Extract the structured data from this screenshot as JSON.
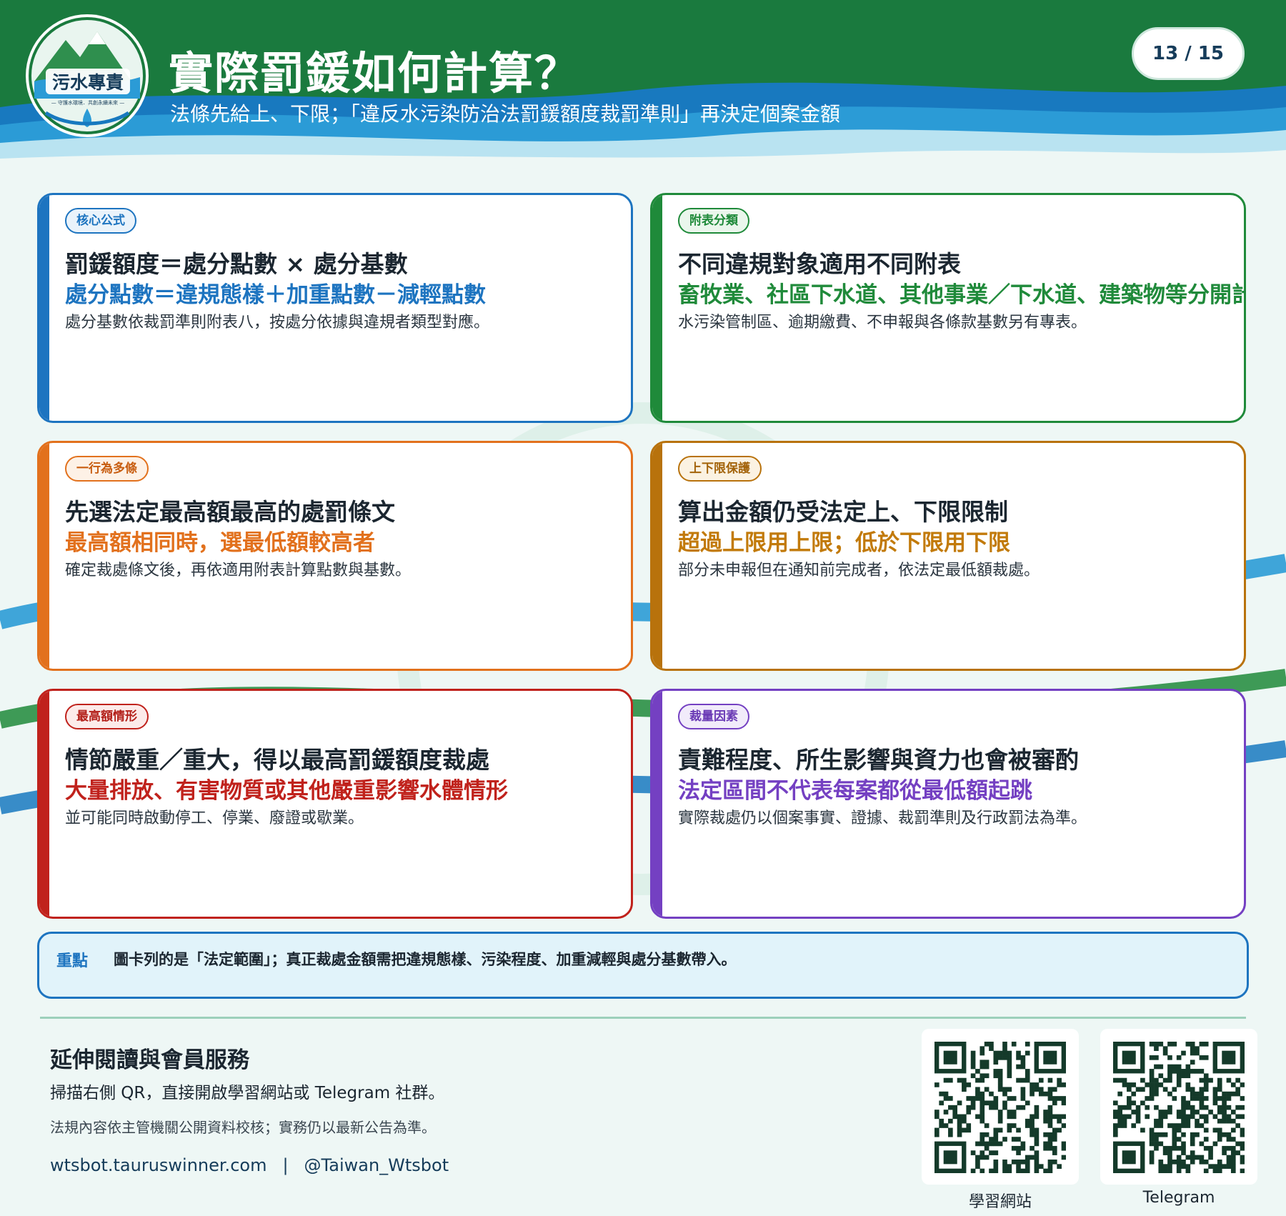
{
  "header": {
    "title": "實際罰鍰如何計算？",
    "subtitle": "法條先給上、下限；「違反水污染防治法罰鍰額度裁罰準則」再決定個案金額",
    "page_indicator": "13 / 15",
    "logo": {
      "icon": "mountain-river-logo",
      "text": "污水專責",
      "tagline": "— 守護水環境．共創永續未來 —"
    }
  },
  "cards": [
    {
      "tag": "核心公式",
      "headline": "罰鍰額度＝處分點數 × 處分基數",
      "accent": "處分點數＝違規態樣＋加重點數－減輕點數",
      "desc": "處分基數依裁罰準則附表八，按處分依據與違規者類型對應。",
      "color": "#1d74c0"
    },
    {
      "tag": "附表分類",
      "headline": "不同違規對象適用不同附表",
      "accent": "畜牧業、社區下水道、其他事業／下水道、建築物等分開計算",
      "desc": "水污染管制區、逾期繳費、不申報與各條款基數另有專表。",
      "color": "#1f8a3a"
    },
    {
      "tag": "一行為多條",
      "headline": "先選法定最高額最高的處罰條文",
      "accent": "最高額相同時，選最低額較高者",
      "desc": "確定裁處條文後，再依適用附表計算點數與基數。",
      "color": "#e2711d"
    },
    {
      "tag": "上下限保護",
      "headline": "算出金額仍受法定上、下限限制",
      "accent": "超過上限用上限；低於下限用下限",
      "desc": "部分未申報但在通知前完成者，依法定最低額裁處。",
      "color": "#b8720c"
    },
    {
      "tag": "最高額情形",
      "headline": "情節嚴重／重大，得以最高罰鍰額度裁處",
      "accent": "大量排放、有害物質或其他嚴重影響水體情形",
      "desc": "並可能同時啟動停工、停業、廢證或歇業。",
      "color": "#c0221c"
    },
    {
      "tag": "裁量因素",
      "headline": "責難程度、所生影響與資力也會被審酌",
      "accent": "法定區間不代表每案都從最低額起跳",
      "desc": "實際裁處仍以個案事實、證據、裁罰準則及行政罰法為準。",
      "color": "#7440c2"
    }
  ],
  "note": {
    "label": "重點",
    "text": "圖卡列的是「法定範圍」；真正裁處金額需把違規態樣、污染程度、加重減輕與處分基數帶入。"
  },
  "footer": {
    "title": "延伸閱讀與會員服務",
    "line1": "掃描右側 QR，直接開啟學習網站或 Telegram 社群。",
    "line2": "法規內容依主管機關公開資料校核；實務仍以最新公告為準。",
    "website": "wtsbot.tauruswinner.com",
    "separator": "|",
    "telegram": "@Taiwan_Wtsbot",
    "qr_codes": [
      {
        "label": "學習網站",
        "icon": "qr-code-icon"
      },
      {
        "label": "Telegram",
        "icon": "qr-code-icon"
      }
    ]
  }
}
